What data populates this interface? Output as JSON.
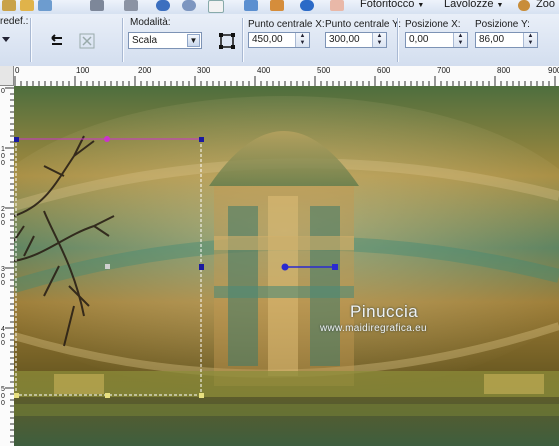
{
  "menubar": {
    "items": [
      {
        "label": "Fotoritocco"
      },
      {
        "label": "Lavolozze"
      },
      {
        "label": "Zoo"
      }
    ]
  },
  "tool_options": {
    "preset_label": "redef.:",
    "mode": {
      "label": "Modalità:",
      "value": "Scala"
    },
    "center_x": {
      "label": "Punto centrale X:",
      "value": "450,00"
    },
    "center_y": {
      "label": "Punto centrale Y:",
      "value": "300,00"
    },
    "pos_x": {
      "label": "Posizione X:",
      "value": "0,00"
    },
    "pos_y": {
      "label": "Posizione Y:",
      "value": "86,00"
    }
  },
  "ruler": {
    "horizontal": [
      "0",
      "100",
      "200",
      "300",
      "400",
      "500",
      "600",
      "700",
      "800",
      "900"
    ],
    "vertical": [
      "0",
      "1\n0\n0",
      "2\n0\n0",
      "3\n0\n0",
      "4\n0\n0",
      "5\n0\n0"
    ]
  },
  "watermark": {
    "title": "Pinuccia",
    "url": "www.maidiregrafica.eu"
  },
  "colors": {
    "selection_handle_magenta": "#cc33cc",
    "selection_handle_blue": "#1a1aa0",
    "pivot": "#2a2ad0"
  }
}
